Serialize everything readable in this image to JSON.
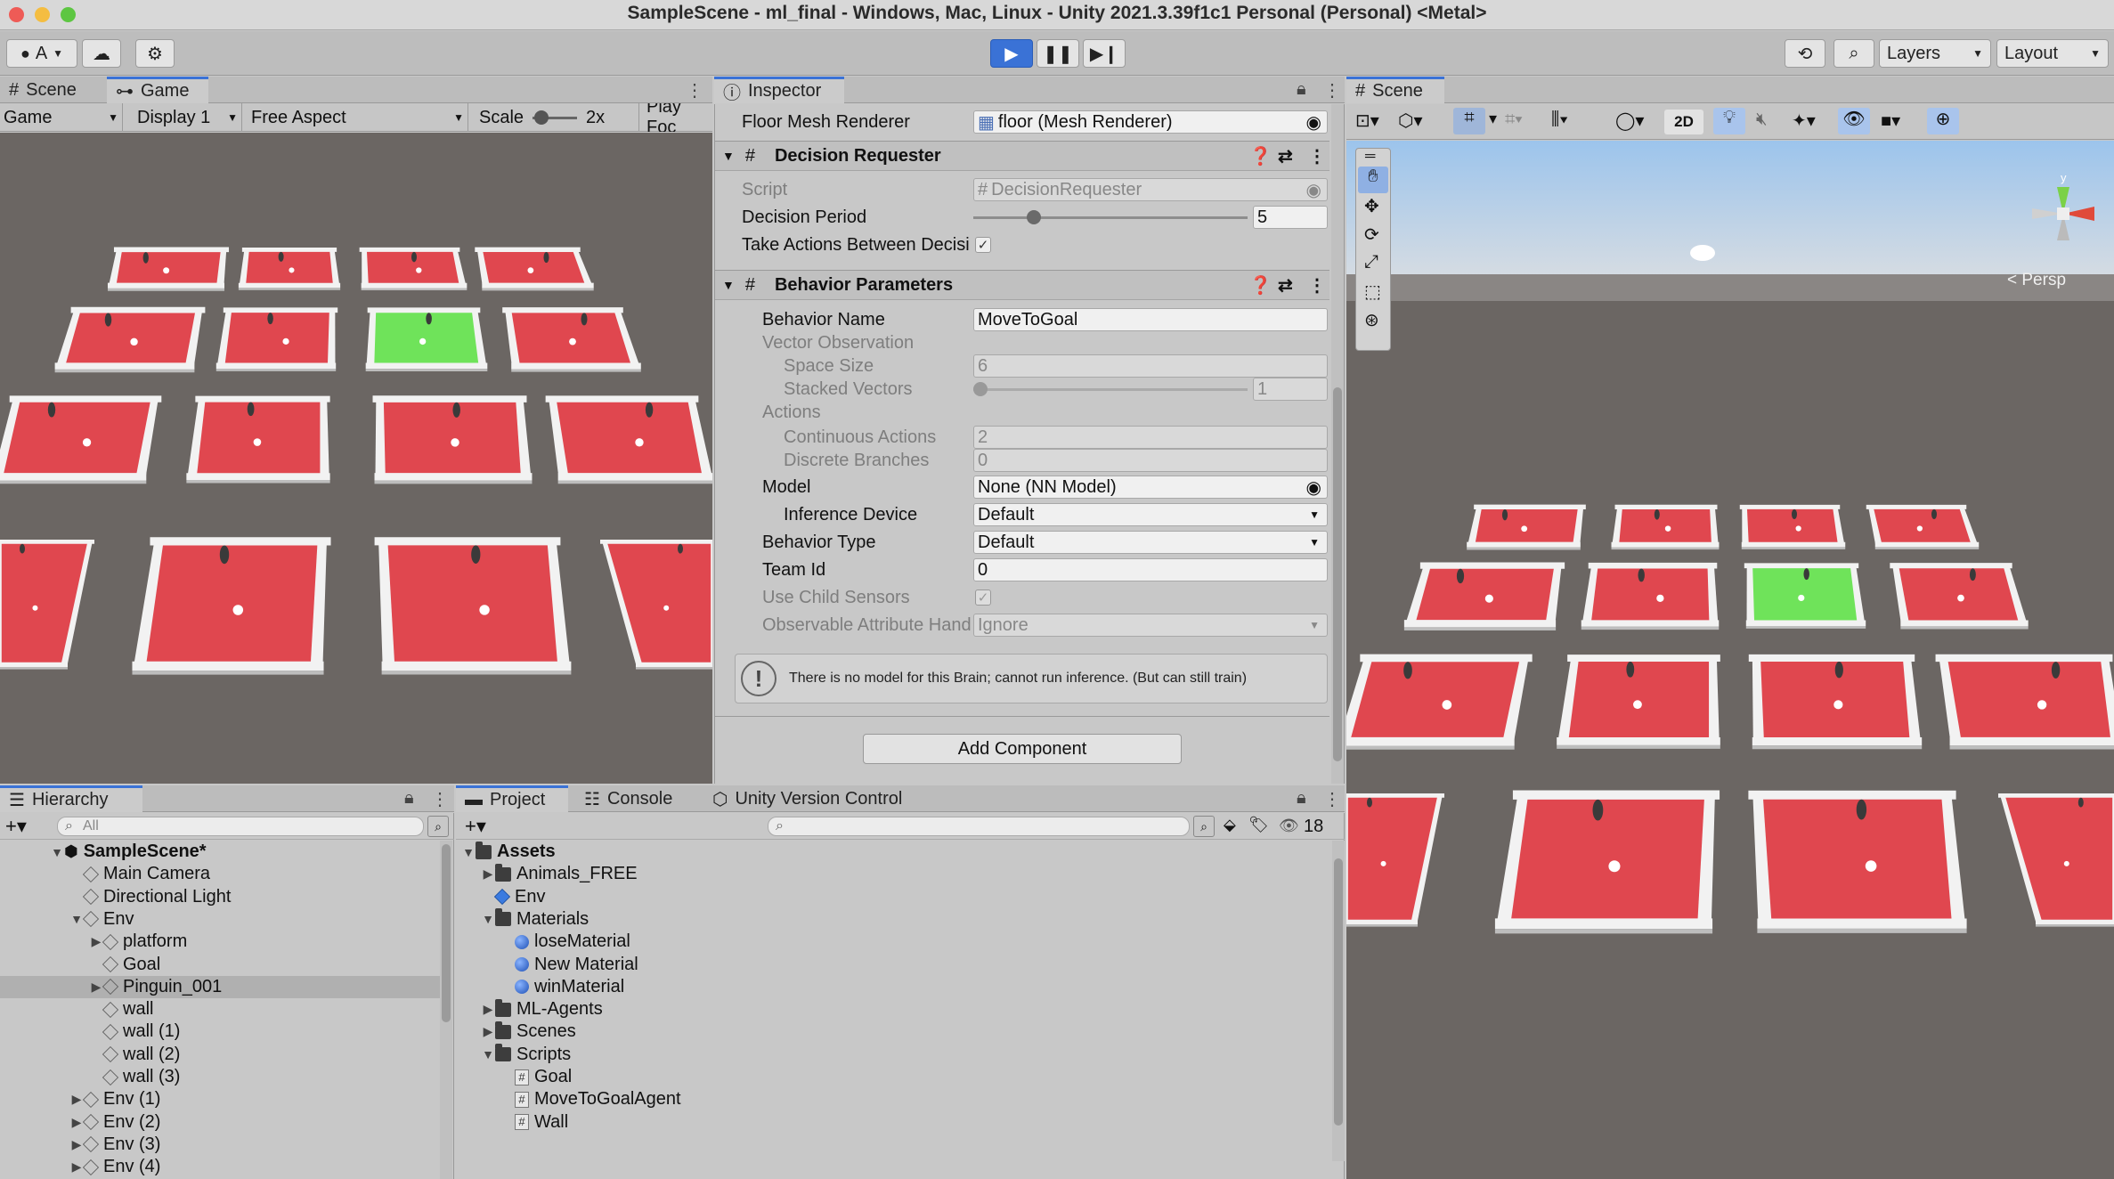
{
  "window": {
    "title": "SampleScene - ml_final - Windows, Mac, Linux - Unity 2021.3.39f1c1 Personal (Personal) <Metal>"
  },
  "toolbar": {
    "account_label": "A",
    "layers_label": "Layers",
    "layout_label": "Layout"
  },
  "game_panel": {
    "tabs": [
      {
        "label": "Scene"
      },
      {
        "label": "Game"
      }
    ],
    "bar": {
      "mode": "Game",
      "display": "Display 1",
      "aspect": "Free Aspect",
      "scale_label": "Scale",
      "scale_value": "2x",
      "play_focused": "Play Foc"
    }
  },
  "inspector": {
    "tab_label": "Inspector",
    "object_label": "Floor Mesh Renderer",
    "object_value": "floor (Mesh Renderer)",
    "decision_requester": {
      "title": "Decision Requester",
      "script_label": "Script",
      "script_value": "DecisionRequester",
      "period_label": "Decision Period",
      "period_value": "5",
      "period_fraction": 0.2,
      "take_actions_label": "Take Actions Between Decisi",
      "take_actions_checked": true
    },
    "behavior_parameters": {
      "title": "Behavior Parameters",
      "behavior_name_label": "Behavior Name",
      "behavior_name_value": "MoveToGoal",
      "vector_observation_label": "Vector Observation",
      "space_size_label": "Space Size",
      "space_size_value": "6",
      "stacked_vectors_label": "Stacked Vectors",
      "stacked_vectors_value": "1",
      "actions_label": "Actions",
      "continuous_actions_label": "Continuous Actions",
      "continuous_actions_value": "2",
      "discrete_branches_label": "Discrete Branches",
      "discrete_branches_value": "0",
      "model_label": "Model",
      "model_value": "None (NN Model)",
      "inference_device_label": "Inference Device",
      "inference_device_value": "Default",
      "behavior_type_label": "Behavior Type",
      "behavior_type_value": "Default",
      "team_id_label": "Team Id",
      "team_id_value": "0",
      "use_child_sensors_label": "Use Child Sensors",
      "observable_label": "Observable Attribute Hand",
      "observable_value": "Ignore",
      "warning": "There is no model for this Brain; cannot run inference. (But can still train)"
    },
    "add_component_label": "Add Component"
  },
  "hierarchy": {
    "tab_label": "Hierarchy",
    "search_placeholder": "All",
    "items": [
      {
        "label": "SampleScene*",
        "kind": "scene",
        "indent": 0,
        "expanded": true
      },
      {
        "label": "Main Camera",
        "kind": "cube",
        "indent": 1
      },
      {
        "label": "Directional Light",
        "kind": "cube",
        "indent": 1
      },
      {
        "label": "Env",
        "kind": "cube",
        "indent": 1,
        "expanded": true
      },
      {
        "label": "platform",
        "kind": "cube",
        "indent": 2,
        "collapsed": true
      },
      {
        "label": "Goal",
        "kind": "cube",
        "indent": 2
      },
      {
        "label": "Pinguin_001",
        "kind": "cube",
        "indent": 2,
        "collapsed": true,
        "selected": true
      },
      {
        "label": "wall",
        "kind": "cube",
        "indent": 2
      },
      {
        "label": "wall (1)",
        "kind": "cube",
        "indent": 2
      },
      {
        "label": "wall (2)",
        "kind": "cube",
        "indent": 2
      },
      {
        "label": "wall (3)",
        "kind": "cube",
        "indent": 2
      },
      {
        "label": "Env (1)",
        "kind": "cube",
        "indent": 1,
        "collapsed": true
      },
      {
        "label": "Env (2)",
        "kind": "cube",
        "indent": 1,
        "collapsed": true
      },
      {
        "label": "Env (3)",
        "kind": "cube",
        "indent": 1,
        "collapsed": true
      },
      {
        "label": "Env (4)",
        "kind": "cube",
        "indent": 1,
        "collapsed": true
      }
    ]
  },
  "project": {
    "tabs": [
      {
        "label": "Project"
      },
      {
        "label": "Console"
      },
      {
        "label": "Unity Version Control"
      }
    ],
    "hidden_count": "18",
    "items": [
      {
        "label": "Assets",
        "kind": "folder",
        "indent": 0,
        "expanded": true,
        "bold": true
      },
      {
        "label": "Animals_FREE",
        "kind": "folder",
        "indent": 1,
        "collapsed": true
      },
      {
        "label": "Env",
        "kind": "prefab",
        "indent": 1
      },
      {
        "label": "Materials",
        "kind": "folder",
        "indent": 1,
        "expanded": true
      },
      {
        "label": "loseMaterial",
        "kind": "material",
        "indent": 2
      },
      {
        "label": "New Material",
        "kind": "material",
        "indent": 2
      },
      {
        "label": "winMaterial",
        "kind": "material",
        "indent": 2
      },
      {
        "label": "ML-Agents",
        "kind": "folder",
        "indent": 1,
        "collapsed": true
      },
      {
        "label": "Scenes",
        "kind": "folder",
        "indent": 1,
        "collapsed": true
      },
      {
        "label": "Scripts",
        "kind": "folder",
        "indent": 1,
        "expanded": true
      },
      {
        "label": "Goal",
        "kind": "script",
        "indent": 2
      },
      {
        "label": "MoveToGoalAgent",
        "kind": "script",
        "indent": 2
      },
      {
        "label": "Wall",
        "kind": "script",
        "indent": 2
      }
    ]
  },
  "scene_panel": {
    "tab_label": "Scene",
    "two_d_label": "2D",
    "persp_label": "< Persp",
    "gizmo_axis": "y"
  },
  "colors": {
    "floor_red": "#e0474f",
    "floor_green": "#6fe35a",
    "wall_white": "#f2f2f2",
    "accent_blue": "#3a72d6",
    "ground": "#6b6663"
  }
}
